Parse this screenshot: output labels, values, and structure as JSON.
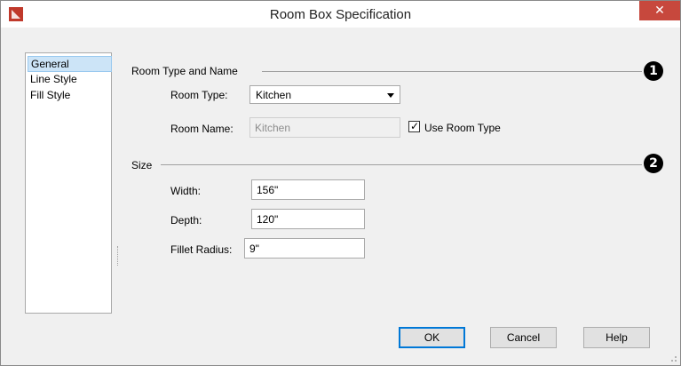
{
  "window": {
    "title": "Room Box Specification"
  },
  "sidebar": {
    "items": [
      {
        "label": "General",
        "selected": true
      },
      {
        "label": "Line Style",
        "selected": false
      },
      {
        "label": "Fill Style",
        "selected": false
      }
    ]
  },
  "section_room": {
    "heading": "Room Type and Name",
    "callout": "1",
    "room_type": {
      "label": "Room Type:",
      "value": "Kitchen"
    },
    "room_name": {
      "label": "Room Name:",
      "value": "Kitchen",
      "disabled": true
    },
    "use_room_type": {
      "label": "Use Room Type",
      "checked": true
    }
  },
  "section_size": {
    "heading": "Size",
    "callout": "2",
    "width": {
      "label": "Width:",
      "value": "156\""
    },
    "depth": {
      "label": "Depth:",
      "value": "120\""
    },
    "fillet_radius": {
      "label": "Fillet Radius:",
      "value": "9\""
    }
  },
  "buttons": {
    "ok": "OK",
    "cancel": "Cancel",
    "help": "Help"
  },
  "colors": {
    "close_button": "#c7483d",
    "selection": "#cce4f7",
    "default_button_border": "#0078d7"
  }
}
